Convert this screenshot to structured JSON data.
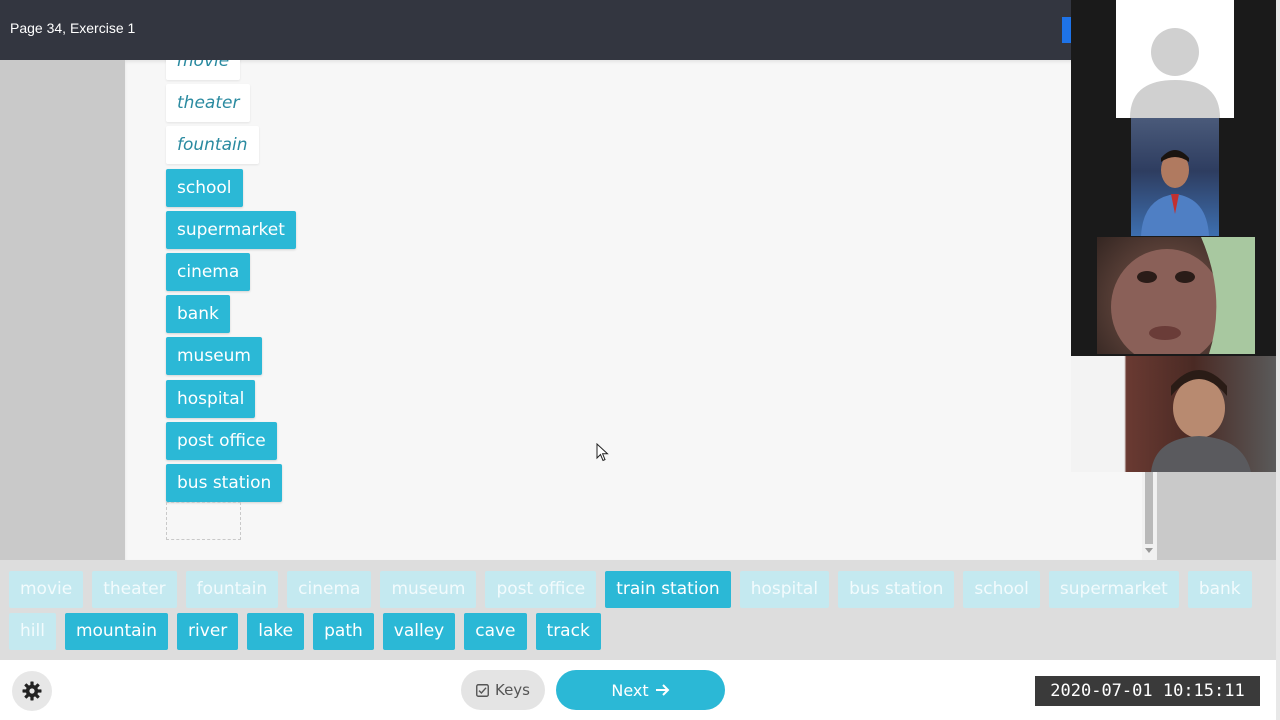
{
  "header": {
    "title": "Page 34, Exercise 1"
  },
  "dropped": {
    "items": [
      {
        "label": "movie",
        "style": "white"
      },
      {
        "label": "theater",
        "style": "white"
      },
      {
        "label": "fountain",
        "style": "white"
      },
      {
        "label": "school",
        "style": "teal"
      },
      {
        "label": "supermarket",
        "style": "teal"
      },
      {
        "label": "cinema",
        "style": "teal"
      },
      {
        "label": "bank",
        "style": "teal"
      },
      {
        "label": "museum",
        "style": "teal"
      },
      {
        "label": "hospital",
        "style": "teal"
      },
      {
        "label": "post office",
        "style": "teal"
      },
      {
        "label": "bus station",
        "style": "teal"
      }
    ]
  },
  "wordbank": {
    "row1": [
      {
        "label": "movie",
        "state": "used"
      },
      {
        "label": "theater",
        "state": "used"
      },
      {
        "label": "fountain",
        "state": "used"
      },
      {
        "label": "cinema",
        "state": "used"
      },
      {
        "label": "museum",
        "state": "used"
      },
      {
        "label": "post office",
        "state": "used"
      },
      {
        "label": "train station",
        "state": "active"
      },
      {
        "label": "hospital",
        "state": "used"
      },
      {
        "label": "bus station",
        "state": "used"
      },
      {
        "label": "school",
        "state": "used"
      },
      {
        "label": "supermarket",
        "state": "used"
      },
      {
        "label": "bank",
        "state": "used"
      }
    ],
    "row2": [
      {
        "label": "hill",
        "state": "used"
      },
      {
        "label": "mountain",
        "state": "active"
      },
      {
        "label": "river",
        "state": "active"
      },
      {
        "label": "lake",
        "state": "active"
      },
      {
        "label": "path",
        "state": "active"
      },
      {
        "label": "valley",
        "state": "active"
      },
      {
        "label": "cave",
        "state": "active"
      },
      {
        "label": "track",
        "state": "active"
      }
    ]
  },
  "footer": {
    "keys_label": "Keys",
    "next_label": "Next",
    "timestamp": "2020-07-01  10:15:11"
  },
  "icons": {
    "settings": "gear-icon",
    "keys": "checkbox-icon",
    "next": "arrow-right-icon",
    "cursor": "mouse-pointer-icon",
    "avatar": "user-avatar-icon"
  },
  "colors": {
    "accent": "#2bb8d6",
    "header_bg": "#333640",
    "used_chip": "#c4e9f0"
  }
}
